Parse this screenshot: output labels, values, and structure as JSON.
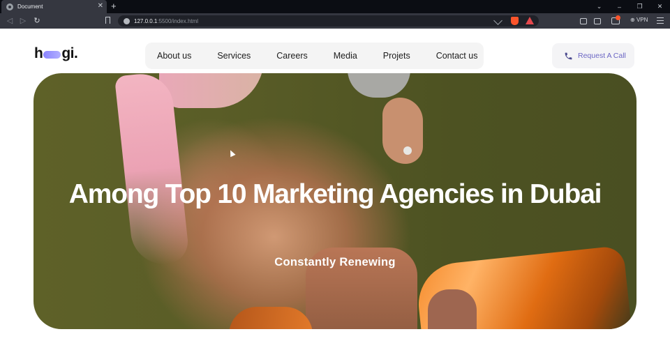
{
  "browser": {
    "tab_title": "Document",
    "tab_close": "✕",
    "new_tab": "+",
    "url_host": "127.0.0.1",
    "url_path": ":5500/index.html",
    "vpn_label": "VPN",
    "window_controls": [
      "⌄",
      "–",
      "❐",
      "✕"
    ]
  },
  "logo": {
    "left": "h",
    "right": "gi."
  },
  "nav": {
    "items": [
      "About us",
      "Services",
      "Careers",
      "Media",
      "Projets",
      "Contact us"
    ]
  },
  "cta": {
    "label": "Request A Call",
    "icon": "phone-icon"
  },
  "hero": {
    "title": "Among Top 10 Marketing Agencies in Dubai",
    "subtitle": "Constantly Renewing"
  },
  "colors": {
    "accent": "#6b66c4",
    "logo_pill": "#8a84ff",
    "hero_bg": "#5a5d27"
  }
}
